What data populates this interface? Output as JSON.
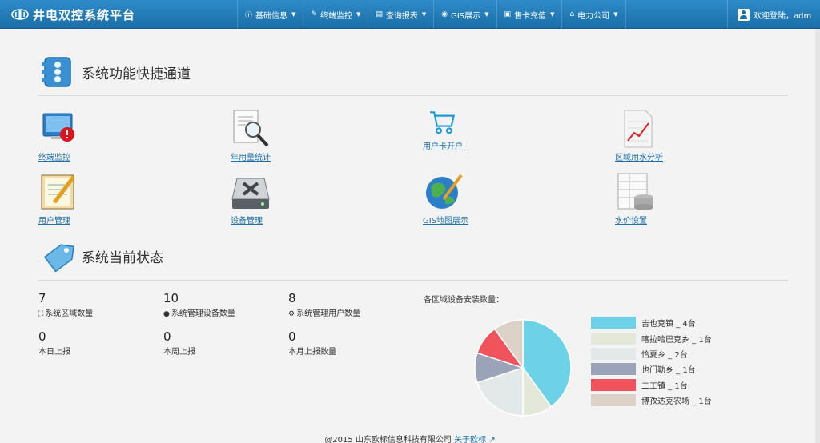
{
  "app": {
    "title": "井电双控系统平台"
  },
  "nav": [
    {
      "icon": "info-icon",
      "label": "基础信息"
    },
    {
      "icon": "monitor-icon",
      "label": "终端监控"
    },
    {
      "icon": "report-icon",
      "label": "查询报表"
    },
    {
      "icon": "eye-icon",
      "label": "GIS展示"
    },
    {
      "icon": "card-icon",
      "label": "售卡充值"
    },
    {
      "icon": "home-icon",
      "label": "电力公司"
    }
  ],
  "user": {
    "greeting": "欢迎登陆，adm"
  },
  "quick_section": {
    "title": "系统功能快捷通道"
  },
  "quick_links": [
    {
      "label": "终端监控",
      "icon": "terminal-monitor-icon"
    },
    {
      "label": "年用量统计",
      "icon": "magnifier-document-icon"
    },
    {
      "label": "用户卡开户",
      "icon": "shopping-cart-icon"
    },
    {
      "label": "区域用水分析",
      "icon": "chart-document-icon"
    },
    {
      "label": "用户管理",
      "icon": "notebook-pencil-icon"
    },
    {
      "label": "设备管理",
      "icon": "device-tools-icon"
    },
    {
      "label": "GIS地图展示",
      "icon": "globe-pencil-icon"
    },
    {
      "label": "水价设置",
      "icon": "database-table-icon"
    }
  ],
  "status_section": {
    "title": "系统当前状态"
  },
  "stats": [
    {
      "value": "7",
      "label": "系统区域数量",
      "icon": "sitemap-icon"
    },
    {
      "value": "10",
      "label": "系统管理设备数量",
      "icon": "user-icon"
    },
    {
      "value": "8",
      "label": "系统管理用户数量",
      "icon": "gears-icon"
    },
    {
      "value": "0",
      "label": "本日上报"
    },
    {
      "value": "0",
      "label": "本周上报"
    },
    {
      "value": "0",
      "label": "本月上报数量"
    }
  ],
  "chart_data": {
    "type": "pie",
    "title": "各区域设备安装数量：",
    "categories": [
      "吉也克镇",
      "喀拉哈巴克乡",
      "恰夏乡",
      "也门勒乡",
      "二工镇",
      "博孜达克农场"
    ],
    "values": [
      4,
      1,
      2,
      1,
      1,
      1
    ],
    "legend_labels": [
      "吉也克镇 _ 4台",
      "喀拉哈巴克乡 _ 1台",
      "恰夏乡 _ 2台",
      "也门勒乡 _ 1台",
      "二工镇 _ 1台",
      "博孜达克农场 _ 1台"
    ],
    "colors": [
      "#6dd1e8",
      "#e4e8d8",
      "#e3e8e8",
      "#9aa3b8",
      "#f0535c",
      "#dcd2c8"
    ],
    "legend": "right"
  },
  "footer": {
    "copyright": "@2015 山东欧标信息科技有限公司",
    "link": "关于欧标"
  }
}
